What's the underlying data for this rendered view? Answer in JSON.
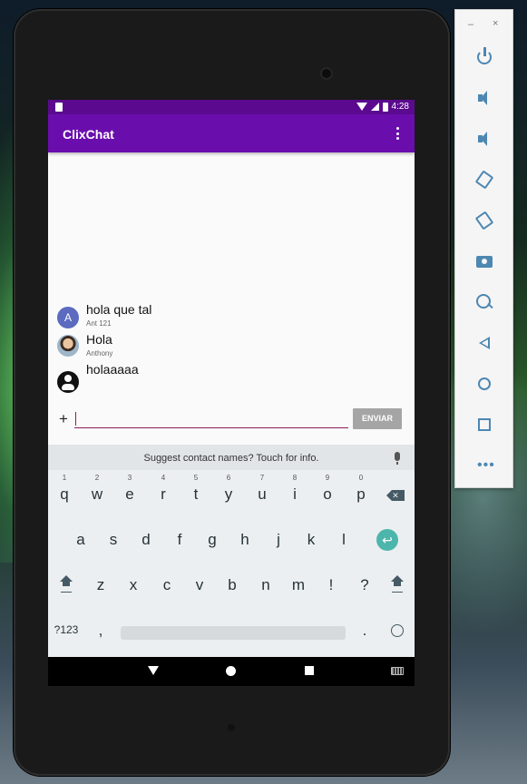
{
  "app": {
    "title": "ClixChat",
    "theme_color": "#6a0dad",
    "status_color": "#5b0a8f"
  },
  "statusbar": {
    "time": "4:28"
  },
  "messages": [
    {
      "text": "hola que tal",
      "author": "Ant 121",
      "avatar_type": "letter",
      "avatar_letter": "A"
    },
    {
      "text": "Hola",
      "author": "Anthony",
      "avatar_type": "photo"
    },
    {
      "text": "holaaaaa",
      "author": "",
      "avatar_type": "generic-person-icon"
    }
  ],
  "composer": {
    "plus_label": "+",
    "input_value": "",
    "send_label": "ENVIAR"
  },
  "keyboard": {
    "suggestion": "Suggest contact names? Touch for info.",
    "row1": [
      {
        "key": "q",
        "hint": "1"
      },
      {
        "key": "w",
        "hint": "2"
      },
      {
        "key": "e",
        "hint": "3"
      },
      {
        "key": "r",
        "hint": "4"
      },
      {
        "key": "t",
        "hint": "5"
      },
      {
        "key": "y",
        "hint": "6"
      },
      {
        "key": "u",
        "hint": "7"
      },
      {
        "key": "i",
        "hint": "8"
      },
      {
        "key": "o",
        "hint": "9"
      },
      {
        "key": "p",
        "hint": "0"
      }
    ],
    "row2": [
      "a",
      "s",
      "d",
      "f",
      "g",
      "h",
      "j",
      "k",
      "l"
    ],
    "row3": [
      "z",
      "x",
      "c",
      "v",
      "b",
      "n",
      "m",
      "!",
      "?"
    ],
    "row4": {
      "symbols": "?123",
      "comma": ",",
      "period": "."
    }
  },
  "nav": {
    "back": "back-icon",
    "home": "home-icon",
    "recents": "recents-icon",
    "keyboard": "keyboard-icon"
  },
  "emulator_toolbar": {
    "minimize": "–",
    "close": "×",
    "buttons": [
      "power",
      "volume-up",
      "volume-down",
      "rotate-left",
      "rotate-right",
      "screenshot",
      "zoom",
      "back",
      "home",
      "overview",
      "more"
    ],
    "more_label": "•••"
  }
}
